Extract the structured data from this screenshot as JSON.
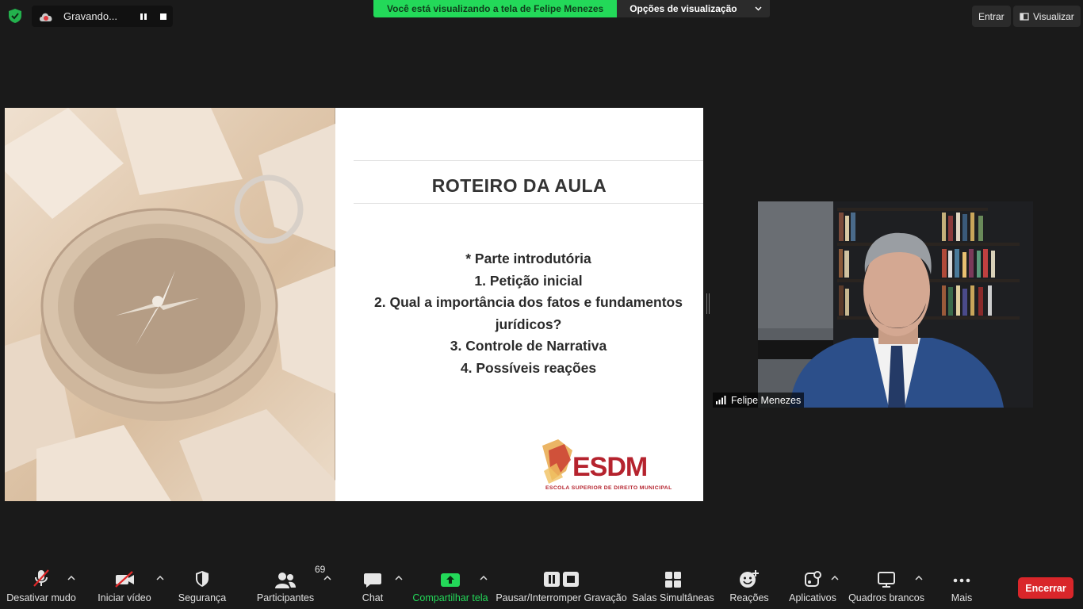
{
  "top": {
    "recording_label": "Gravando...",
    "banner_text": "Você está visualizando a tela de Felipe Menezes",
    "view_options": "Opções de visualização",
    "enter_label": "Entrar",
    "view_label": "Visualizar"
  },
  "slide": {
    "title": "ROTEIRO DA AULA",
    "items": [
      "* Parte introdutória",
      "1. Petição inicial",
      "2. Qual a importância dos fatos e fundamentos",
      "jurídicos?",
      "3. Controle de Narrativa",
      "4. Possíveis reações"
    ],
    "logo_text": "ESDM",
    "logo_subtitle": "ESCOLA SUPERIOR DE DIREITO MUNICIPAL"
  },
  "video": {
    "participant_name": "Felipe Menezes"
  },
  "toolbar": {
    "mute": "Desativar mudo",
    "video": "Iniciar vídeo",
    "security": "Segurança",
    "participants": "Participantes",
    "participants_count": "69",
    "chat": "Chat",
    "share": "Compartilhar tela",
    "record": "Pausar/Interromper Gravação",
    "breakout": "Salas Simultâneas",
    "reactions": "Reações",
    "apps": "Aplicativos",
    "whiteboards": "Quadros brancos",
    "more": "Mais",
    "end": "Encerrar"
  },
  "colors": {
    "banner_green": "#23d959",
    "share_green": "#23d959",
    "end_red": "#d9262a",
    "logo_red": "#b5232e"
  }
}
